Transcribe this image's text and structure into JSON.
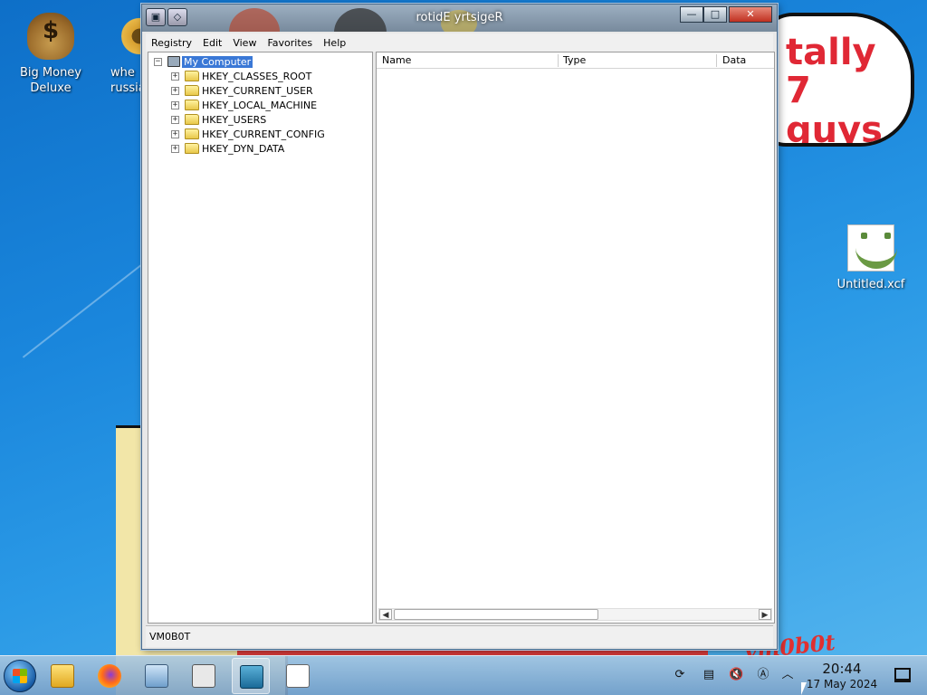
{
  "desktop": {
    "icons": [
      {
        "label": "Big Money Deluxe",
        "icon": "moneybag-icon"
      },
      {
        "label": "whe russia",
        "icon": "gear-icon"
      },
      {
        "label": "Untitled.xcf",
        "icon": "smiley-image-icon"
      }
    ],
    "wallpaper_text": {
      "bubble_line1": "tally",
      "bubble_line2": "7 guys",
      "handwriting": "vm0b0t"
    }
  },
  "window": {
    "title": "rotidE yrtsigeR",
    "controls": {
      "minimize": "—",
      "maximize": "□",
      "close": "✕"
    },
    "menu": [
      "Registry",
      "Edit",
      "View",
      "Favorites",
      "Help"
    ],
    "tree": {
      "root": "My Computer",
      "keys": [
        "HKEY_CLASSES_ROOT",
        "HKEY_CURRENT_USER",
        "HKEY_LOCAL_MACHINE",
        "HKEY_USERS",
        "HKEY_CURRENT_CONFIG",
        "HKEY_DYN_DATA"
      ],
      "expander_collapsed": "+",
      "expander_expanded": "−"
    },
    "list": {
      "columns": [
        "Name",
        "Type",
        "Data"
      ]
    },
    "status": "VM0B0T"
  },
  "taskbar": {
    "items": [
      "start-button",
      "file-explorer",
      "firefox",
      "control-panel",
      "task-manager",
      "registry-editor",
      "notepad"
    ],
    "active_item": "registry-editor",
    "clock": {
      "time": "20:44",
      "date": "17 May 2024"
    },
    "tray": [
      "update-icon",
      "clipboard-icon",
      "volume-muted-icon",
      "keyboard-icon",
      "chevron-up-icon"
    ]
  }
}
